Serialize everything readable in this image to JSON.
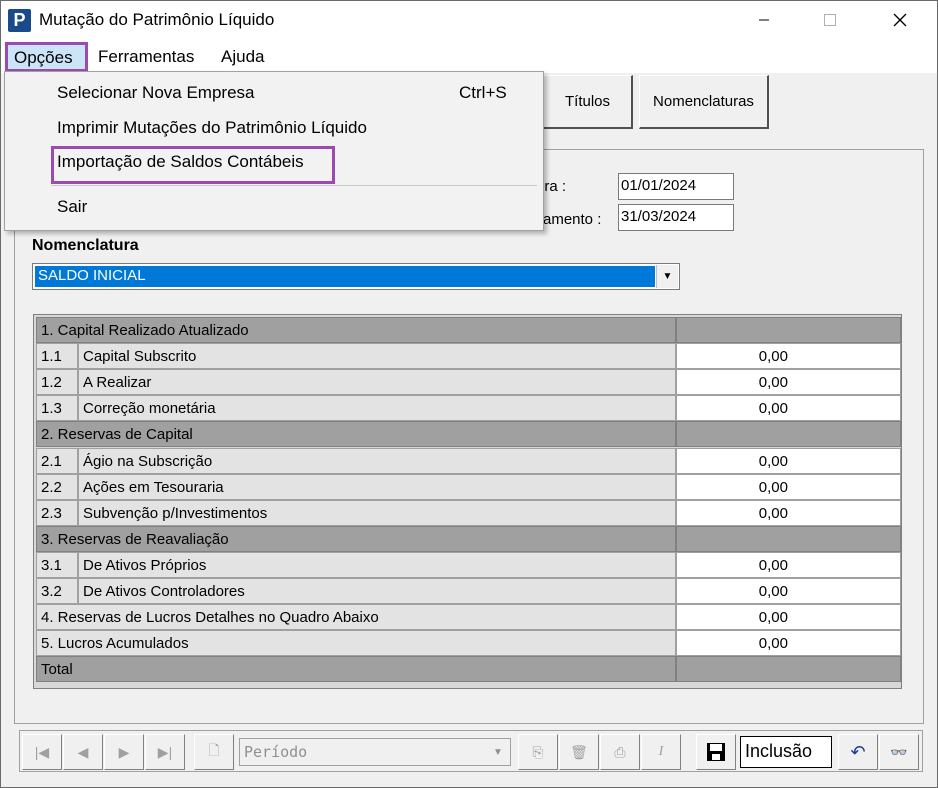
{
  "window": {
    "title": "Mutação do Patrimônio Líquido",
    "app_icon_letter": "P"
  },
  "menubar": {
    "items": [
      "Opções",
      "Ferramentas",
      "Ajuda"
    ]
  },
  "dropdown": {
    "items": [
      {
        "label": "Selecionar Nova Empresa",
        "shortcut": "Ctrl+S"
      },
      {
        "label": "Imprimir Mutações do Patrimônio Líquido",
        "shortcut": ""
      },
      {
        "label": "Importação de Saldos Contábeis",
        "shortcut": ""
      },
      {
        "label": "Sair",
        "shortcut": ""
      }
    ]
  },
  "toolbar": {
    "titulos": "Títulos",
    "nomenclaturas": "Nomenclaturas"
  },
  "dates": {
    "abertura_label": "ura :",
    "abertura_value": "01/01/2024",
    "encerramento_label": "ramento :",
    "encerramento_value": "31/03/2024"
  },
  "nomenclatura": {
    "label": "Nomenclatura",
    "selected": "SALDO INICIAL"
  },
  "grid": {
    "rows": [
      {
        "type": "header",
        "label": "1. Capital Realizado Atualizado",
        "value": ""
      },
      {
        "type": "item",
        "num": "1.1",
        "label": "Capital Subscrito",
        "value": "0,00"
      },
      {
        "type": "item",
        "num": "1.2",
        "label": "A Realizar",
        "value": "0,00"
      },
      {
        "type": "item",
        "num": "1.3",
        "label": "Correção monetária",
        "value": "0,00"
      },
      {
        "type": "header",
        "label": "2. Reservas  de Capital",
        "value": ""
      },
      {
        "type": "item",
        "num": "2.1",
        "label": "Ágio na Subscrição",
        "value": "0,00"
      },
      {
        "type": "item",
        "num": "2.2",
        "label": "Ações em Tesouraria",
        "value": "0,00"
      },
      {
        "type": "item",
        "num": "2.3",
        "label": "Subvenção p/Investimentos",
        "value": "0,00"
      },
      {
        "type": "header",
        "label": "3. Reservas de Reavaliação",
        "value": ""
      },
      {
        "type": "item",
        "num": "3.1",
        "label": "De Ativos Próprios",
        "value": "0,00"
      },
      {
        "type": "item",
        "num": "3.2",
        "label": "De Ativos Controladores",
        "value": "0,00"
      },
      {
        "type": "item",
        "num": "",
        "label": "4. Reservas de Lucros Detalhes no Quadro Abaixo",
        "value": "0,00"
      },
      {
        "type": "item",
        "num": "",
        "label": "5. Lucros Acumulados",
        "value": "0,00"
      },
      {
        "type": "header",
        "label": "Total",
        "value": ""
      }
    ]
  },
  "navbar": {
    "periodo_placeholder": "Período",
    "status": "Inclusão"
  }
}
